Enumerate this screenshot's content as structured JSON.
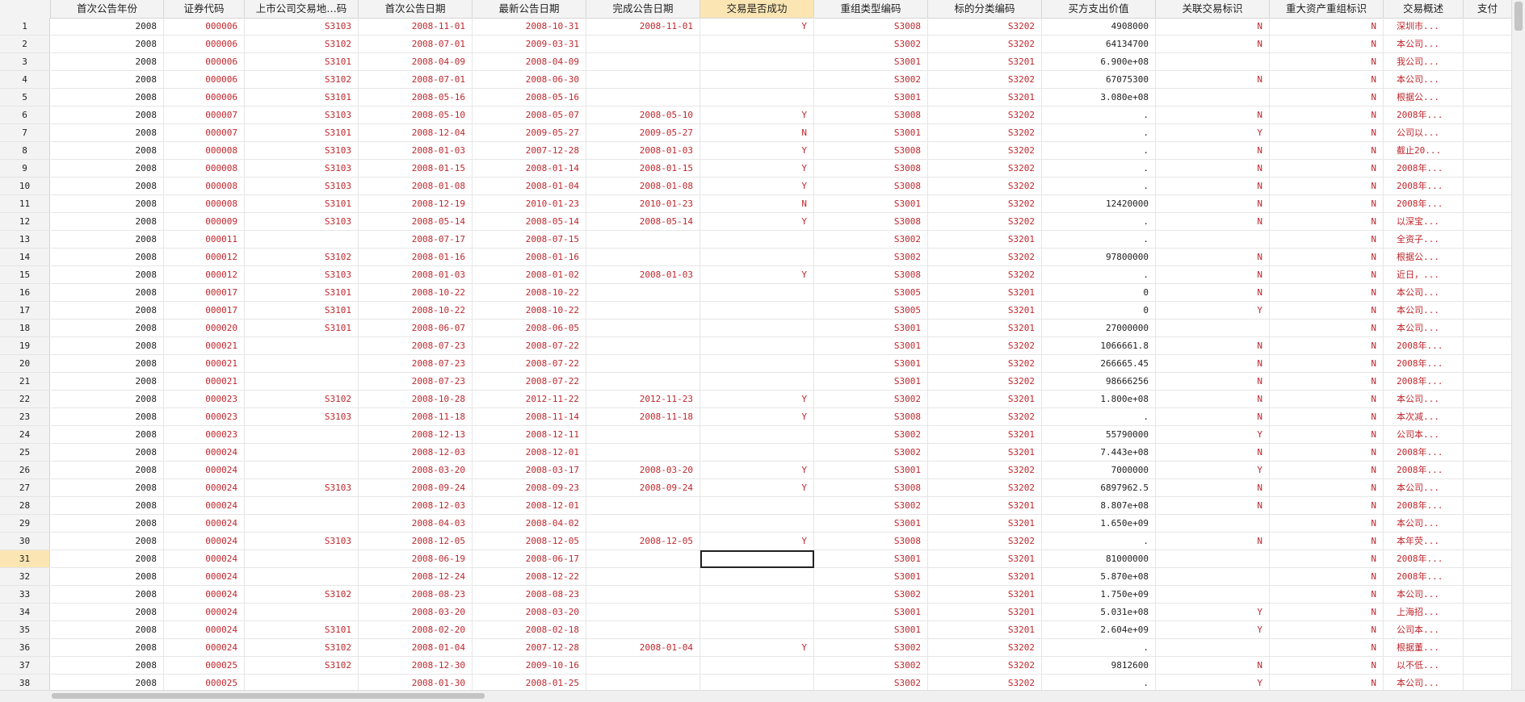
{
  "columns": [
    "首次公告年份",
    "证券代码",
    "上市公司交易地…码",
    "首次公告日期",
    "最新公告日期",
    "完成公告日期",
    "交易是否成功",
    "重组类型编码",
    "标的分类编码",
    "买方支出价值",
    "关联交易标识",
    "重大资产重组标识",
    "交易概述",
    "支付"
  ],
  "selected_column": 6,
  "selected_row": 30,
  "rows": [
    [
      "1",
      "2008",
      "000006",
      "S3103",
      "2008-11-01",
      "2008-10-31",
      "2008-11-01",
      "Y",
      "S3008",
      "S3202",
      "4908000",
      "N",
      "N",
      "深圳市..."
    ],
    [
      "2",
      "2008",
      "000006",
      "S3102",
      "2008-07-01",
      "2009-03-31",
      "",
      "",
      "S3002",
      "S3202",
      "64134700",
      "N",
      "N",
      "本公司..."
    ],
    [
      "3",
      "2008",
      "000006",
      "S3101",
      "2008-04-09",
      "2008-04-09",
      "",
      "",
      "S3001",
      "S3201",
      "6.900e+08",
      "",
      "N",
      "我公司..."
    ],
    [
      "4",
      "2008",
      "000006",
      "S3102",
      "2008-07-01",
      "2008-06-30",
      "",
      "",
      "S3002",
      "S3202",
      "67075300",
      "N",
      "N",
      "本公司..."
    ],
    [
      "5",
      "2008",
      "000006",
      "S3101",
      "2008-05-16",
      "2008-05-16",
      "",
      "",
      "S3001",
      "S3201",
      "3.080e+08",
      "",
      "N",
      "根据公..."
    ],
    [
      "6",
      "2008",
      "000007",
      "S3103",
      "2008-05-10",
      "2008-05-07",
      "2008-05-10",
      "Y",
      "S3008",
      "S3202",
      ".",
      "N",
      "N",
      "2008年..."
    ],
    [
      "7",
      "2008",
      "000007",
      "S3101",
      "2008-12-04",
      "2009-05-27",
      "2009-05-27",
      "N",
      "S3001",
      "S3202",
      ".",
      "Y",
      "N",
      "公司以..."
    ],
    [
      "8",
      "2008",
      "000008",
      "S3103",
      "2008-01-03",
      "2007-12-28",
      "2008-01-03",
      "Y",
      "S3008",
      "S3202",
      ".",
      "N",
      "N",
      "截止20..."
    ],
    [
      "9",
      "2008",
      "000008",
      "S3103",
      "2008-01-15",
      "2008-01-14",
      "2008-01-15",
      "Y",
      "S3008",
      "S3202",
      ".",
      "N",
      "N",
      "2008年..."
    ],
    [
      "10",
      "2008",
      "000008",
      "S3103",
      "2008-01-08",
      "2008-01-04",
      "2008-01-08",
      "Y",
      "S3008",
      "S3202",
      ".",
      "N",
      "N",
      "2008年..."
    ],
    [
      "11",
      "2008",
      "000008",
      "S3101",
      "2008-12-19",
      "2010-01-23",
      "2010-01-23",
      "N",
      "S3001",
      "S3202",
      "12420000",
      "N",
      "N",
      "2008年..."
    ],
    [
      "12",
      "2008",
      "000009",
      "S3103",
      "2008-05-14",
      "2008-05-14",
      "2008-05-14",
      "Y",
      "S3008",
      "S3202",
      ".",
      "N",
      "N",
      "以深宝..."
    ],
    [
      "13",
      "2008",
      "000011",
      "",
      "2008-07-17",
      "2008-07-15",
      "",
      "",
      "S3002",
      "S3201",
      ".",
      "",
      "N",
      "全资子..."
    ],
    [
      "14",
      "2008",
      "000012",
      "S3102",
      "2008-01-16",
      "2008-01-16",
      "",
      "",
      "S3002",
      "S3202",
      "97800000",
      "N",
      "N",
      "根据公..."
    ],
    [
      "15",
      "2008",
      "000012",
      "S3103",
      "2008-01-03",
      "2008-01-02",
      "2008-01-03",
      "Y",
      "S3008",
      "S3202",
      ".",
      "N",
      "N",
      "近日，..."
    ],
    [
      "16",
      "2008",
      "000017",
      "S3101",
      "2008-10-22",
      "2008-10-22",
      "",
      "",
      "S3005",
      "S3201",
      "0",
      "N",
      "N",
      "本公司..."
    ],
    [
      "17",
      "2008",
      "000017",
      "S3101",
      "2008-10-22",
      "2008-10-22",
      "",
      "",
      "S3005",
      "S3201",
      "0",
      "Y",
      "N",
      "本公司..."
    ],
    [
      "18",
      "2008",
      "000020",
      "S3101",
      "2008-06-07",
      "2008-06-05",
      "",
      "",
      "S3001",
      "S3201",
      "27000000",
      "",
      "N",
      "本公司..."
    ],
    [
      "19",
      "2008",
      "000021",
      "",
      "2008-07-23",
      "2008-07-22",
      "",
      "",
      "S3001",
      "S3202",
      "1066661.8",
      "N",
      "N",
      "2008年..."
    ],
    [
      "20",
      "2008",
      "000021",
      "",
      "2008-07-23",
      "2008-07-22",
      "",
      "",
      "S3001",
      "S3202",
      "266665.45",
      "N",
      "N",
      "2008年..."
    ],
    [
      "21",
      "2008",
      "000021",
      "",
      "2008-07-23",
      "2008-07-22",
      "",
      "",
      "S3001",
      "S3202",
      "98666256",
      "N",
      "N",
      "2008年..."
    ],
    [
      "22",
      "2008",
      "000023",
      "S3102",
      "2008-10-28",
      "2012-11-22",
      "2012-11-23",
      "Y",
      "S3002",
      "S3201",
      "1.800e+08",
      "N",
      "N",
      "本公司..."
    ],
    [
      "23",
      "2008",
      "000023",
      "S3103",
      "2008-11-18",
      "2008-11-14",
      "2008-11-18",
      "Y",
      "S3008",
      "S3202",
      ".",
      "N",
      "N",
      "本次减..."
    ],
    [
      "24",
      "2008",
      "000023",
      "",
      "2008-12-13",
      "2008-12-11",
      "",
      "",
      "S3002",
      "S3201",
      "55790000",
      "Y",
      "N",
      "公司本..."
    ],
    [
      "25",
      "2008",
      "000024",
      "",
      "2008-12-03",
      "2008-12-01",
      "",
      "",
      "S3002",
      "S3201",
      "7.443e+08",
      "N",
      "N",
      "2008年..."
    ],
    [
      "26",
      "2008",
      "000024",
      "",
      "2008-03-20",
      "2008-03-17",
      "2008-03-20",
      "Y",
      "S3001",
      "S3202",
      "7000000",
      "Y",
      "N",
      "2008年..."
    ],
    [
      "27",
      "2008",
      "000024",
      "S3103",
      "2008-09-24",
      "2008-09-23",
      "2008-09-24",
      "Y",
      "S3008",
      "S3202",
      "6897962.5",
      "N",
      "N",
      "本公司..."
    ],
    [
      "28",
      "2008",
      "000024",
      "",
      "2008-12-03",
      "2008-12-01",
      "",
      "",
      "S3002",
      "S3201",
      "8.807e+08",
      "N",
      "N",
      "2008年..."
    ],
    [
      "29",
      "2008",
      "000024",
      "",
      "2008-04-03",
      "2008-04-02",
      "",
      "",
      "S3001",
      "S3201",
      "1.650e+09",
      "",
      "N",
      "本公司..."
    ],
    [
      "30",
      "2008",
      "000024",
      "S3103",
      "2008-12-05",
      "2008-12-05",
      "2008-12-05",
      "Y",
      "S3008",
      "S3202",
      ".",
      "N",
      "N",
      "本年荧..."
    ],
    [
      "31",
      "2008",
      "000024",
      "",
      "2008-06-19",
      "2008-06-17",
      "",
      "",
      "S3001",
      "S3201",
      "81000000",
      "",
      "N",
      "2008年..."
    ],
    [
      "32",
      "2008",
      "000024",
      "",
      "2008-12-24",
      "2008-12-22",
      "",
      "",
      "S3001",
      "S3201",
      "5.870e+08",
      "",
      "N",
      "2008年..."
    ],
    [
      "33",
      "2008",
      "000024",
      "S3102",
      "2008-08-23",
      "2008-08-23",
      "",
      "",
      "S3002",
      "S3201",
      "1.750e+09",
      "",
      "N",
      "本公司..."
    ],
    [
      "34",
      "2008",
      "000024",
      "",
      "2008-03-20",
      "2008-03-20",
      "",
      "",
      "S3001",
      "S3201",
      "5.031e+08",
      "Y",
      "N",
      "上海招..."
    ],
    [
      "35",
      "2008",
      "000024",
      "S3101",
      "2008-02-20",
      "2008-02-18",
      "",
      "",
      "S3001",
      "S3201",
      "2.604e+09",
      "Y",
      "N",
      "公司本..."
    ],
    [
      "36",
      "2008",
      "000024",
      "S3102",
      "2008-01-04",
      "2007-12-28",
      "2008-01-04",
      "Y",
      "S3002",
      "S3202",
      ".",
      "",
      "N",
      "根据董..."
    ],
    [
      "37",
      "2008",
      "000025",
      "S3102",
      "2008-12-30",
      "2009-10-16",
      "",
      "",
      "S3002",
      "S3202",
      "9812600",
      "N",
      "N",
      "以不低..."
    ],
    [
      "38",
      "2008",
      "000025",
      "",
      "2008-01-30",
      "2008-01-25",
      "",
      "",
      "S3002",
      "S3202",
      ".",
      "Y",
      "N",
      "本公司..."
    ]
  ]
}
